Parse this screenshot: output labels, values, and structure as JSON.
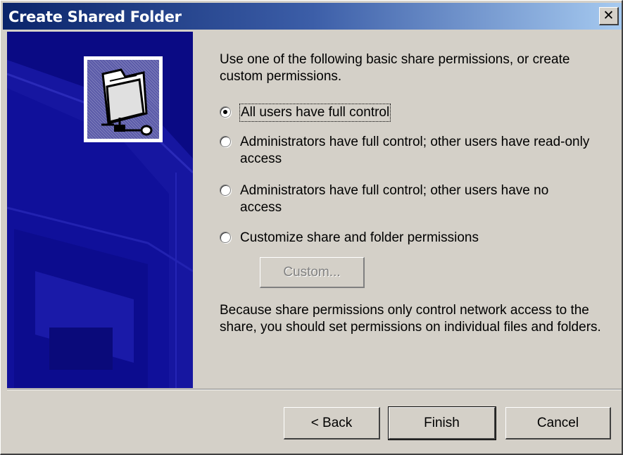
{
  "window": {
    "title": "Create Shared Folder",
    "close_glyph": "✕"
  },
  "intro": "Use one of the following basic share permissions, or create custom permissions.",
  "options": [
    {
      "label": "All users have full control",
      "checked": true
    },
    {
      "label": "Administrators have full control; other users have read-only access",
      "checked": false
    },
    {
      "label": "Administrators have full control; other users have no access",
      "checked": false
    },
    {
      "label": "Customize share and folder permissions",
      "checked": false
    }
  ],
  "custom_button": "Custom...",
  "note": "Because share permissions only control network access to the share, you should set permissions on individual files and folders.",
  "buttons": {
    "back": "< Back",
    "finish": "Finish",
    "cancel": "Cancel"
  },
  "icons": {
    "wizard": "shared-folder-icon",
    "close": "close-icon"
  },
  "colors": {
    "side_panel": "#0a0a84",
    "titlebar_start": "#0a246a",
    "titlebar_end": "#a6caf0",
    "dialog": "#d4d0c8"
  }
}
